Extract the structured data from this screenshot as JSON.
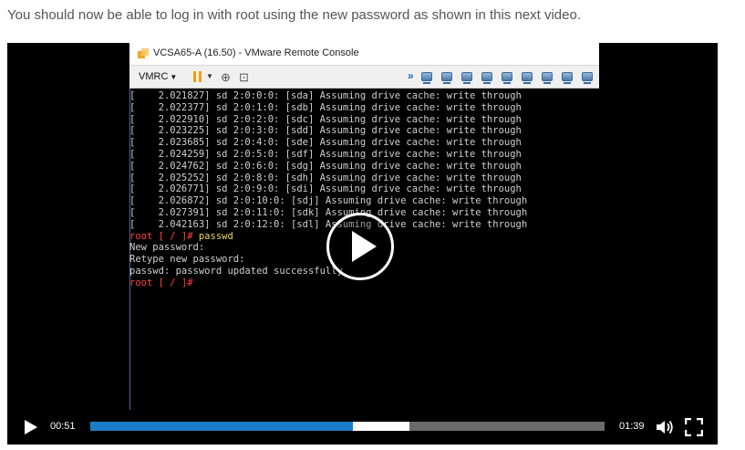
{
  "intro_text": "You should now be able to log in with root using the new password as shown in this next video.",
  "vmrc": {
    "title": "VCSA65-A (16.50) - VMware Remote Console",
    "menu_label": "VMRC",
    "more_glyph": "»"
  },
  "console_lines": [
    "[    2.021827] sd 2:0:0:0: [sda] Assuming drive cache: write through",
    "[    2.022377] sd 2:0:1:0: [sdb] Assuming drive cache: write through",
    "[    2.022910] sd 2:0:2:0: [sdc] Assuming drive cache: write through",
    "[    2.023225] sd 2:0:3:0: [sdd] Assuming drive cache: write through",
    "[    2.023685] sd 2:0:4:0: [sde] Assuming drive cache: write through",
    "[    2.024259] sd 2:0:5:0: [sdf] Assuming drive cache: write through",
    "[    2.024762] sd 2:0:6:0: [sdg] Assuming drive cache: write through",
    "[    2.025252] sd 2:0:8:0: [sdh] Assuming drive cache: write through",
    "[    2.026771] sd 2:0:9:0: [sdi] Assuming drive cache: write through",
    "[    2.026872] sd 2:0:10:0: [sdj] Assuming drive cache: write through",
    "[    2.027391] sd 2:0:11:0: [sdk] Assuming drive cache: write through",
    "[    2.042163] sd 2:0:12:0: [sdl] Assuming drive cache: write through"
  ],
  "prompt1": {
    "root": "root [ / ]# ",
    "cmd": "passwd"
  },
  "console_output": [
    "New password:",
    "Retype new password:",
    "passwd: password updated successfully"
  ],
  "prompt2": {
    "root": "root [ / ]# "
  },
  "player": {
    "current_time": "00:51",
    "total_time": "01:39",
    "progress_played": 0.51,
    "progress_buffered": 0.62,
    "accent_color": "#1b7dc7"
  },
  "icons": {
    "big_play": "play-icon",
    "play": "play-icon",
    "volume": "volume-icon",
    "fullscreen": "fullscreen-icon"
  }
}
